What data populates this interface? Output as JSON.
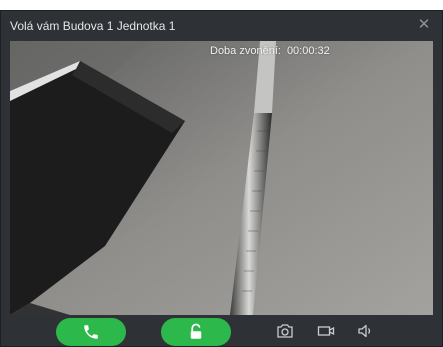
{
  "window": {
    "title": "Volá vám Budova 1 Jednotka 1",
    "close_icon": "close-icon"
  },
  "video": {
    "ring_time_label": "Doba zvonění:",
    "ring_time_value": "00:00:32"
  },
  "controls": {
    "answer_icon": "phone-icon",
    "unlock_icon": "unlock-icon",
    "snapshot_icon": "camera-icon",
    "record_icon": "video-camera-icon",
    "volume_icon": "speaker-icon"
  },
  "colors": {
    "window_bg": "#2e3136",
    "accent_green": "#2db84b",
    "title_text": "#e6e6e6",
    "icon_gray": "#c9ccd0"
  }
}
